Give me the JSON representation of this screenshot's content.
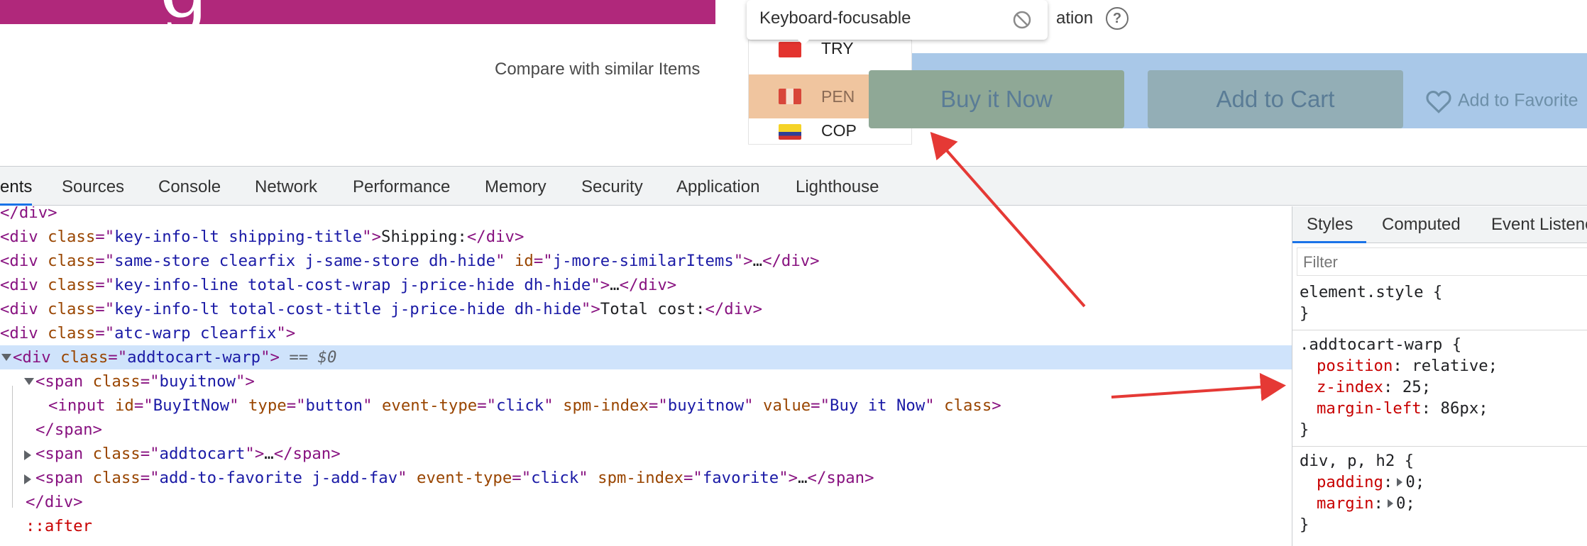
{
  "page": {
    "compare_link": "Compare with similar Items",
    "currencies": [
      "TRY",
      "PEN",
      "COP"
    ],
    "buttons": {
      "buy_now": "Buy it Now",
      "add_to_cart": "Add to Cart",
      "add_to_favorite": "Add to Favorite"
    },
    "tooltip": {
      "label": "Keyboard-focusable",
      "trailing_text": "ation",
      "help_symbol": "?"
    },
    "icons": [
      "blocked-icon",
      "help-icon",
      "heart-icon"
    ],
    "colors": {
      "banner": "#b0287b",
      "buttons_band": "#a9c8e8",
      "highlight_overlay": "#f0c59f",
      "arrow": "#e53935"
    }
  },
  "devtools": {
    "tabs": [
      "ents",
      "Sources",
      "Console",
      "Network",
      "Performance",
      "Memory",
      "Security",
      "Application",
      "Lighthouse"
    ],
    "active_tab": "ents",
    "styles_tabs": [
      "Styles",
      "Computed",
      "Event Listene"
    ],
    "filter_placeholder": "Filter",
    "dom_lines": [
      {
        "close": "</div>"
      },
      {
        "open_tag": "div",
        "attrs": [
          [
            "class",
            "key-info-lt shipping-title"
          ]
        ],
        "text": "Shipping:",
        "close": "</div>"
      },
      {
        "open_tag": "div",
        "attrs": [
          [
            "class",
            "same-store clearfix j-same-store dh-hide"
          ],
          [
            "id",
            "j-more-similarItems"
          ]
        ],
        "text": "…",
        "close": "</div>"
      },
      {
        "open_tag": "div",
        "attrs": [
          [
            "class",
            "key-info-line total-cost-wrap j-price-hide dh-hide"
          ]
        ],
        "text": "…",
        "close": "</div>"
      },
      {
        "open_tag": "div",
        "attrs": [
          [
            "class",
            "key-info-lt total-cost-title j-price-hide dh-hide"
          ]
        ],
        "text": "Total cost:",
        "close": "</div>"
      },
      {
        "open_tag": "div",
        "attrs": [
          [
            "class",
            "atc-warp clearfix"
          ]
        ]
      },
      {
        "open_tag": "div",
        "attrs": [
          [
            "class",
            "addtocart-warp"
          ]
        ],
        "suffix": " == $0",
        "selected": true,
        "toggle": "open"
      },
      {
        "open_tag": "span",
        "attrs": [
          [
            "class",
            "buyitnow"
          ]
        ],
        "toggle": "open"
      },
      {
        "open_tag": "input",
        "attrs": [
          [
            "id",
            "BuyItNow"
          ],
          [
            "type",
            "button"
          ],
          [
            "event-type",
            "click"
          ],
          [
            "spm-index",
            "buyitnow"
          ],
          [
            "value",
            "Buy it Now"
          ],
          [
            "class",
            null
          ]
        ]
      },
      {
        "close": "</span>"
      },
      {
        "open_tag": "span",
        "attrs": [
          [
            "class",
            "addtocart"
          ]
        ],
        "text": "…",
        "close": "</span>",
        "toggle": "closed"
      },
      {
        "open_tag": "span",
        "attrs": [
          [
            "class",
            "add-to-favorite j-add-fav"
          ],
          [
            "event-type",
            "click"
          ],
          [
            "spm-index",
            "favorite"
          ]
        ],
        "text": "…",
        "close": "</span>",
        "toggle": "closed"
      },
      {
        "close": "</div>"
      },
      {
        "pseudo": "::after"
      }
    ],
    "style_rules": [
      {
        "selector": "element.style",
        "declarations": []
      },
      {
        "selector": ".addtocart-warp",
        "declarations": [
          [
            "position",
            "relative"
          ],
          [
            "z-index",
            "25"
          ],
          [
            "margin-left",
            "86px"
          ]
        ]
      },
      {
        "selector": "div, p, h2",
        "declarations": [
          [
            "padding",
            "0",
            true
          ],
          [
            "margin",
            "0",
            true
          ]
        ]
      }
    ]
  }
}
